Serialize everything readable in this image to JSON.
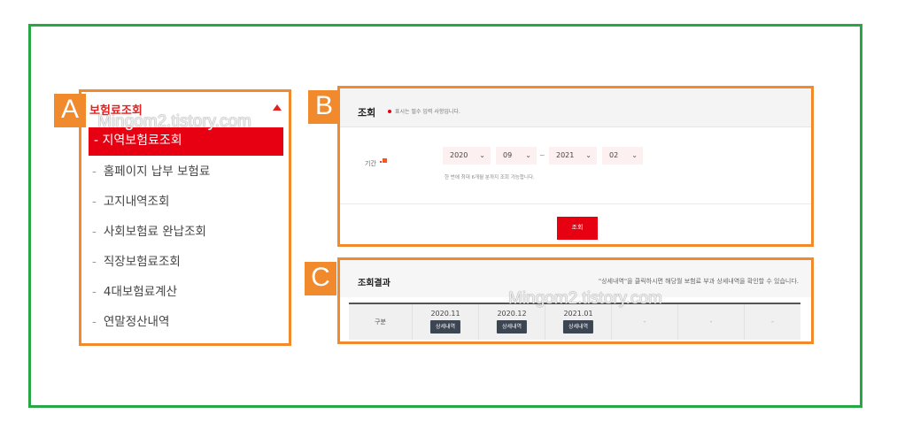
{
  "tags": {
    "a": "A",
    "b": "B",
    "c": "C"
  },
  "watermark": "Mingom2.tistory.com",
  "menu": {
    "title": "보험료조회",
    "active": "- 지역보험료조회",
    "items": [
      "홈페이지 납부 보험료",
      "고지내역조회",
      "사회보험료 완납조회",
      "직장보험료조회",
      "4대보험료계산",
      "연말정산내역"
    ],
    "dash": "-"
  },
  "search": {
    "title": "조회",
    "required_note": "표시는 필수 입력 사항입니다.",
    "period_label": "기간",
    "from_year": "2020",
    "from_month": "09",
    "separator": "~",
    "to_year": "2021",
    "to_month": "02",
    "note": "한 번에 최대 6개월 분까지 조회 가능합니다.",
    "button": "조회"
  },
  "results": {
    "title": "조회결과",
    "note": "\"상세내역\"을 클릭하시면 해당월 보험료 부과 상세내역을 확인할 수 있습니다.",
    "row_label": "구분",
    "months": [
      "2020.11",
      "2020.12",
      "2021.01"
    ],
    "detail_button": "상세내역",
    "empty": "-"
  },
  "colors": {
    "accent": "#e60012",
    "highlight": "#f08a2c",
    "frame": "#27a844",
    "detail_button": "#3c4552"
  }
}
